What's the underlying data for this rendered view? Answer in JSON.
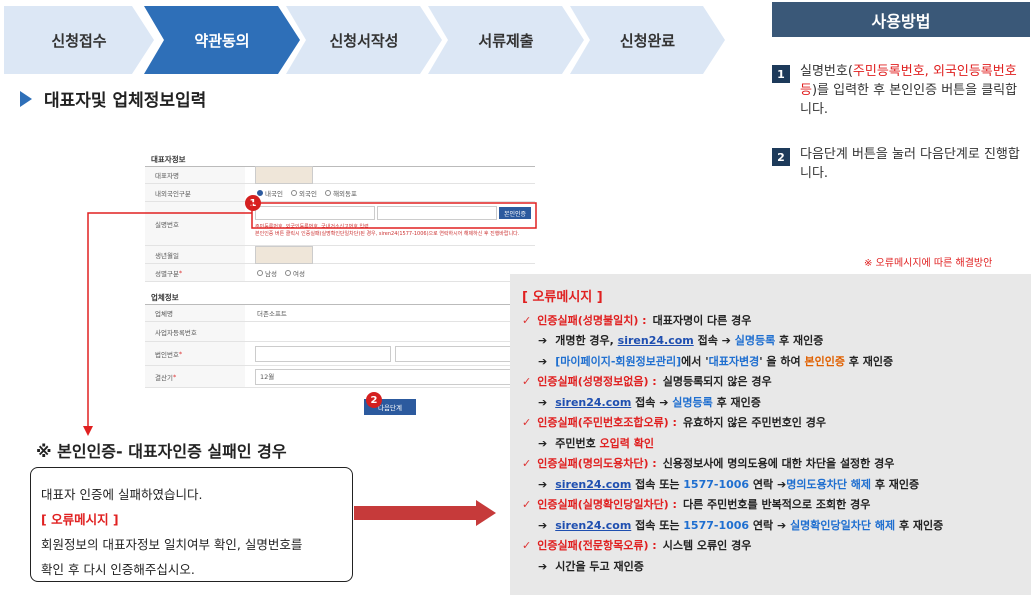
{
  "steps": [
    "신청접수",
    "약관동의",
    "신청서작성",
    "서류제출",
    "신청완료"
  ],
  "active_step_index": 1,
  "section_title": "대표자및 업체정보입력",
  "form": {
    "rep_header": "대표자정보",
    "rep_name": "대표자명",
    "nationality_label": "내외국인구분",
    "nationality_options": [
      "내국인",
      "외국인",
      "해외동포"
    ],
    "realname_label": "실명번호",
    "verify_btn": "본인인증",
    "note1": "주민등록번호, 외국인등록번호, 국내거소신고번호 입력",
    "note2": "본인인증 버튼 클릭시 인증실패(실명확인단일차단)된 경우, siren24(1577-1006)으로 연락하시어 해제하신 후 진행바랍니다.",
    "birth_label": "생년월일",
    "gender_label": "성별구분",
    "gender_options": [
      "남성",
      "여성"
    ],
    "company_header": "업체정보",
    "company_name": "업체명",
    "company_value": "더존소프트",
    "bizno_label": "사업자등록번호",
    "corpno_label": "법인번호",
    "fiscal_label": "결산기",
    "fiscal_value": "12월",
    "next_btn": "다음단계",
    "badge1": "1",
    "badge2": "2"
  },
  "fail": {
    "title": "※ 본인인증- 대표자인증 실패인 경우",
    "line1": "대표자 인증에 실패하였습니다.",
    "line2": "[ 오류메시지 ]",
    "line3": "회원정보의 대표자정보 일치여부 확인, 실명번호를",
    "line4": "확인 후 다시 인증해주십시오."
  },
  "help": {
    "title": "사용방법",
    "n1": "1",
    "n2": "2",
    "i1a": "실명번호(",
    "i1b": "주민등록번호, 외국인등록번호 등",
    "i1c": ")를 입력한 후 본인인증 버튼을 클릭합니다.",
    "i2": "다음단계 버튼을 눌러 다음단계로 진행합니다.",
    "note": "※ 오류메시지에 따른 해결방안"
  },
  "errors": {
    "header": "[ 오류메시지 ]",
    "r1": "인증실패(성명불일치) :",
    "r1t": "대표자명이 다른 경우",
    "r1a": "개명한 경우,",
    "r1a_link": "siren24.com",
    "r1a_mid": "접속 ➔",
    "r1a_blue": "실명등록",
    "r1a_end": "후 재인증",
    "r1b_blue": "[마이페이지-회원정보관리]",
    "r1b_mid": "에서 '",
    "r1b_blue2": "대표자변경",
    "r1b_mid2": "' 을 하여",
    "r1b_orange": "본인인증",
    "r1b_end": "후 재인증",
    "r2": "인증실패(성명정보없음) :",
    "r2t": "실명등록되지 않은 경우",
    "r2a_link": "siren24.com",
    "r2a_mid": "접속 ➔",
    "r2a_blue": "실명등록",
    "r2a_end": "후 재인증",
    "r3": "인증실패(주민번호조합오류) :",
    "r3t": "유효하지 않은 주민번호인 경우",
    "r3a": "주민번호",
    "r3a_red": "오입력 확인",
    "r4": "인증실패(명의도용차단) :",
    "r4t": "신용정보사에 명의도용에 대한 차단을 설정한 경우",
    "r4a_link": "siren24.com",
    "r4a_mid": "접속 또는",
    "r4a_blue": "1577-1006",
    "r4a_mid2": "연락 ➔",
    "r4a_blue2": "명의도용차단 해제",
    "r4a_end": "후 재인증",
    "r5": "인증실패(실명확인당일차단) :",
    "r5t": "다른 주민번호를 반복적으로 조회한 경우",
    "r5a_link": "siren24.com",
    "r5a_mid": "접속 또는",
    "r5a_blue": "1577-1006",
    "r5a_mid2": "연락 ➔",
    "r5a_blue2": "실명확인당일차단 해제",
    "r5a_end": "후 재인증",
    "r6": "인증실패(전문항목오류) :",
    "r6t": "시스템 오류인 경우",
    "r6a": "시간을 두고 재인증"
  },
  "colors": {
    "step_bg": "#dce7f5",
    "step_active": "#2e6fb8",
    "accent_red": "#e02020",
    "help_head": "#3a5878"
  }
}
